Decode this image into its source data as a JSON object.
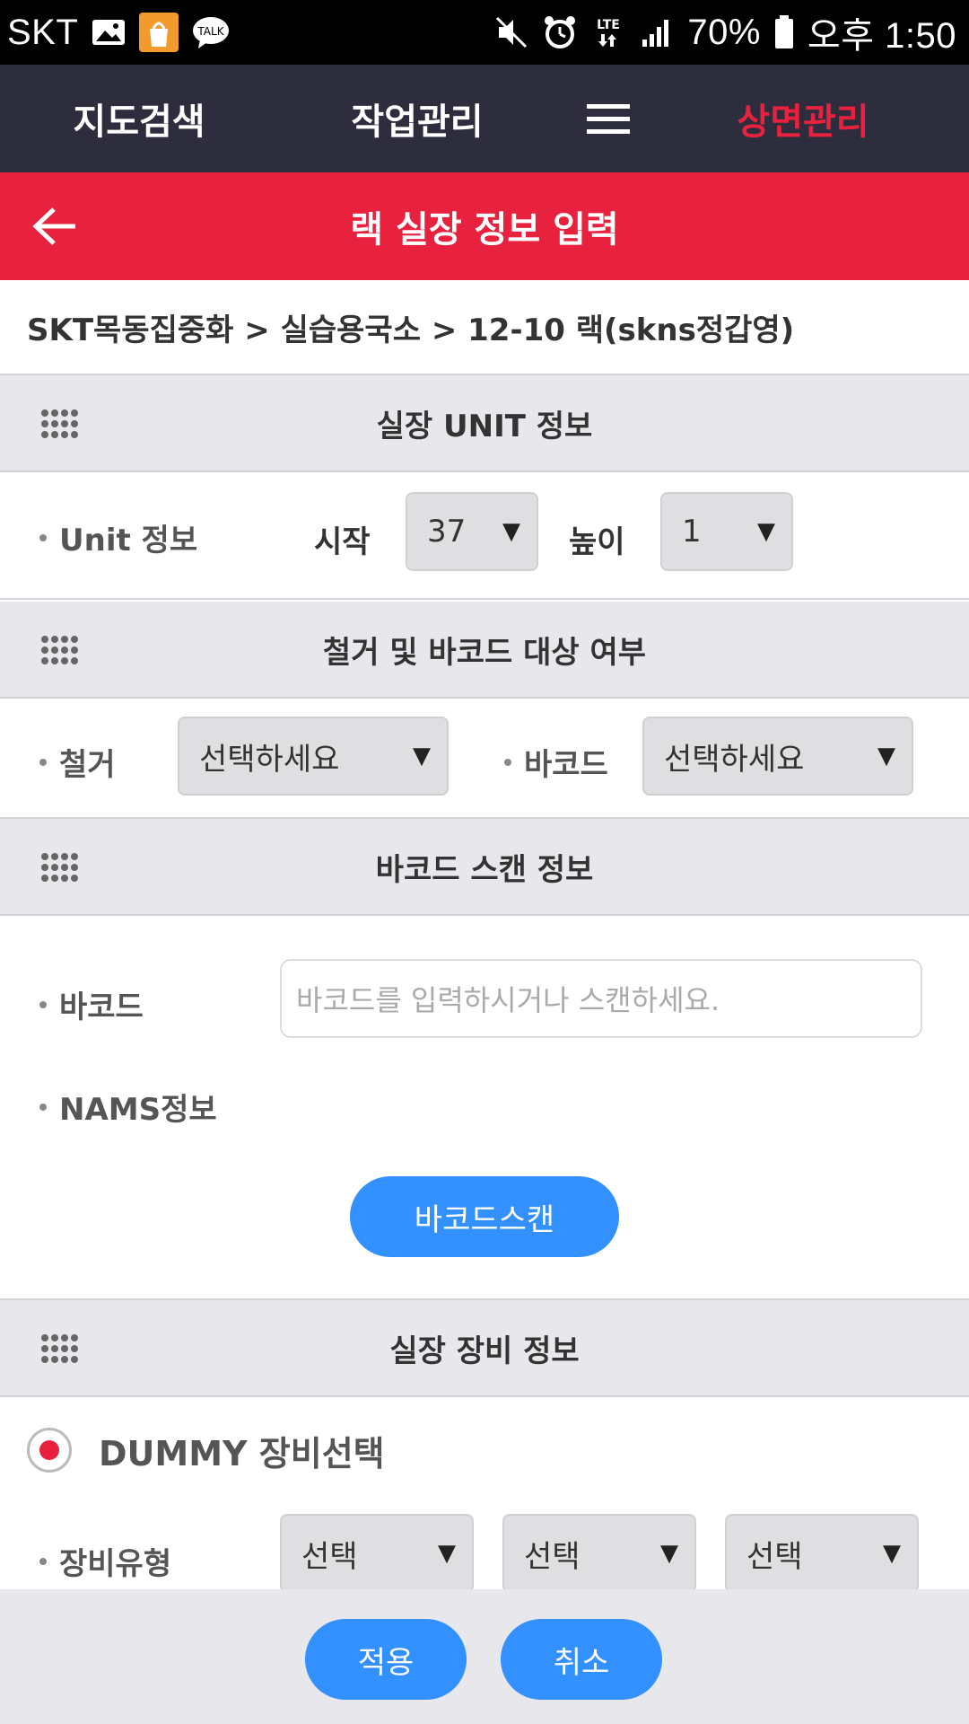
{
  "status_bar": {
    "carrier": "SKT",
    "notification_icons": [
      "gallery-icon",
      "shopping-bag-icon",
      "talk-icon"
    ],
    "battery": "70%",
    "time": "오후 1:50"
  },
  "top_nav": {
    "items": [
      {
        "label": "지도검색"
      },
      {
        "label": "작업관리"
      },
      {
        "label": "상면관리"
      }
    ]
  },
  "title_bar": {
    "title": "랙 실장 정보 입력"
  },
  "breadcrumb": "SKT목동집중화 > 실습용국소 > 12-10 랙(skns정갑영)",
  "unit_section": {
    "title": "실장 UNIT 정보",
    "label": "Unit 정보",
    "start_label": "시작",
    "start_value": "37",
    "height_label": "높이",
    "height_value": "1"
  },
  "removal_section": {
    "title": "철거 및 바코드 대상 여부",
    "removal_label": "철거",
    "removal_value": "선택하세요",
    "barcode_label": "바코드",
    "barcode_value": "선택하세요"
  },
  "scan_section": {
    "title": "바코드 스캔 정보",
    "barcode_label": "바코드",
    "barcode_placeholder": "바코드를 입력하시거나 스캔하세요.",
    "nams_label": "NAMS정보",
    "scan_button": "바코드스캔"
  },
  "equipment_section": {
    "title": "실장 장비 정보",
    "dummy_radio_label": "DUMMY 장비선택",
    "type_label": "장비유형",
    "type_selects": [
      "선택",
      "선택",
      "선택"
    ]
  },
  "footer": {
    "apply_button": "적용",
    "cancel_button": "취소"
  },
  "colors": {
    "nav_bg": "#2d2d3e",
    "accent_red": "#e8223e",
    "button_blue": "#3390ff",
    "section_bg": "#e8e8ec"
  }
}
